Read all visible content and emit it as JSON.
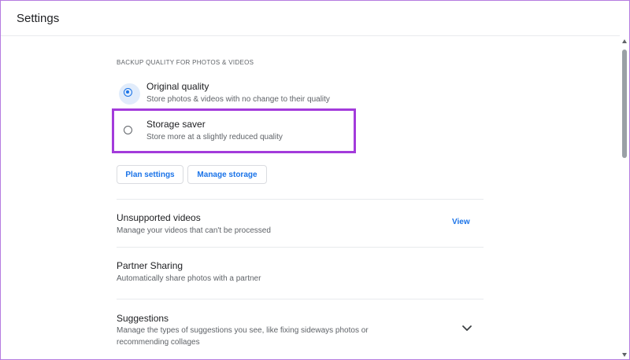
{
  "header": {
    "title": "Settings"
  },
  "backup": {
    "section_label": "BACKUP QUALITY FOR PHOTOS & VIDEOS",
    "options": [
      {
        "title": "Original quality",
        "description": "Store photos & videos with no change to their quality",
        "selected": true
      },
      {
        "title": "Storage saver",
        "description": "Store more at a slightly reduced quality",
        "selected": false
      }
    ],
    "buttons": {
      "plan_settings": "Plan settings",
      "manage_storage": "Manage storage"
    }
  },
  "rows": [
    {
      "title": "Unsupported videos",
      "description": "Manage your videos that can't be processed",
      "action": "View"
    },
    {
      "title": "Partner Sharing",
      "description": "Automatically share photos with a partner"
    },
    {
      "title": "Suggestions",
      "description_line1": "Manage the types of suggestions you see, like fixing sideways photos or",
      "description_line2": "recommending collages",
      "icon": "chevron-down-icon"
    }
  ],
  "colors": {
    "accent": "#1a73e8",
    "highlight": "#a33bdb",
    "selected_halo": "#e1ecfb"
  }
}
